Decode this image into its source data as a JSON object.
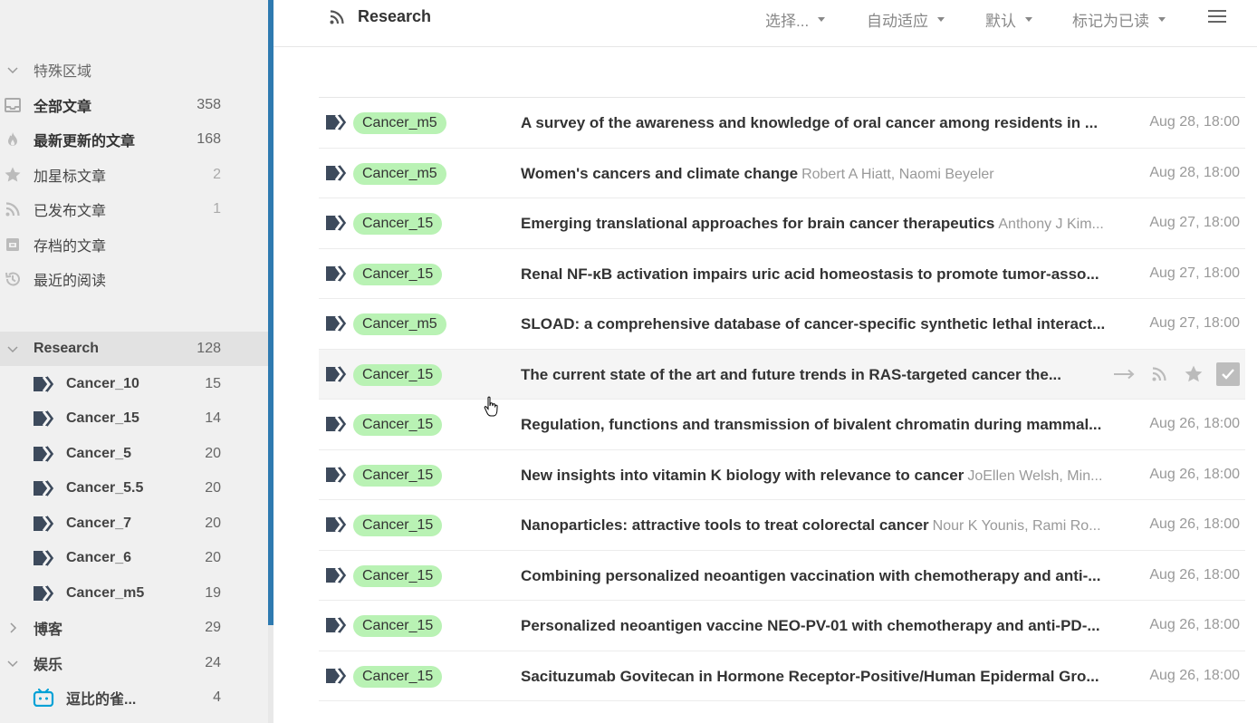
{
  "sidebar": {
    "special_section": {
      "label": "特殊区域"
    },
    "special_items": [
      {
        "label": "全部文章",
        "count": "358",
        "icon": "inbox-icon",
        "bold": true
      },
      {
        "label": "最新更新的文章",
        "count": "168",
        "icon": "fire-icon",
        "bold": true
      },
      {
        "label": "加星标文章",
        "count": "2",
        "icon": "star-icon",
        "bold": false
      },
      {
        "label": "已发布文章",
        "count": "1",
        "icon": "rss-icon",
        "bold": false
      },
      {
        "label": "存档的文章",
        "count": "",
        "icon": "archive-icon",
        "bold": false
      },
      {
        "label": "最近的阅读",
        "count": "",
        "icon": "history-icon",
        "bold": false
      }
    ],
    "research": {
      "label": "Research",
      "count": "128"
    },
    "research_feeds": [
      {
        "label": "Cancer_10",
        "count": "15"
      },
      {
        "label": "Cancer_15",
        "count": "14"
      },
      {
        "label": "Cancer_5",
        "count": "20"
      },
      {
        "label": "Cancer_5.5",
        "count": "20"
      },
      {
        "label": "Cancer_7",
        "count": "20"
      },
      {
        "label": "Cancer_6",
        "count": "20"
      },
      {
        "label": "Cancer_m5",
        "count": "19"
      }
    ],
    "blog": {
      "label": "博客",
      "count": "29"
    },
    "entertainment": {
      "label": "娱乐",
      "count": "24"
    },
    "entertainment_feeds": [
      {
        "label": "逗比的雀...",
        "count": "4"
      }
    ]
  },
  "header": {
    "title": "Research",
    "select_label": "选择...",
    "adapt_label": "自动适应",
    "default_label": "默认",
    "mark_read_label": "标记为已读"
  },
  "articles": [
    {
      "tag": "Cancer_m5",
      "title": "A survey of the awareness and knowledge of oral cancer among residents in ...",
      "authors": "",
      "date": "Aug 28, 18:00"
    },
    {
      "tag": "Cancer_m5",
      "title": "Women's cancers and climate change",
      "authors": "Robert A Hiatt, Naomi Beyeler",
      "date": "Aug 28, 18:00"
    },
    {
      "tag": "Cancer_15",
      "title": "Emerging translational approaches for brain cancer therapeutics",
      "authors": "Anthony J Kim...",
      "date": "Aug 27, 18:00"
    },
    {
      "tag": "Cancer_15",
      "title": "Renal NF-κB activation impairs uric acid homeostasis to promote tumor-asso...",
      "authors": "",
      "date": "Aug 27, 18:00"
    },
    {
      "tag": "Cancer_m5",
      "title": "SLOAD: a comprehensive database of cancer-specific synthetic lethal interact...",
      "authors": "",
      "date": "Aug 27, 18:00"
    },
    {
      "tag": "Cancer_15",
      "title": "The current state of the art and future trends in RAS-targeted cancer the...",
      "authors": "",
      "date": "",
      "hover": true
    },
    {
      "tag": "Cancer_15",
      "title": "Regulation, functions and transmission of bivalent chromatin during mammal...",
      "authors": "",
      "date": "Aug 26, 18:00"
    },
    {
      "tag": "Cancer_15",
      "title": "New insights into vitamin K biology with relevance to cancer",
      "authors": "JoEllen Welsh, Min...",
      "date": "Aug 26, 18:00"
    },
    {
      "tag": "Cancer_15",
      "title": "Nanoparticles: attractive tools to treat colorectal cancer",
      "authors": "Nour K Younis, Rami Ro...",
      "date": "Aug 26, 18:00"
    },
    {
      "tag": "Cancer_15",
      "title": "Combining personalized neoantigen vaccination with chemotherapy and anti-...",
      "authors": "",
      "date": "Aug 26, 18:00"
    },
    {
      "tag": "Cancer_15",
      "title": "Personalized neoantigen vaccine NEO-PV-01 with chemotherapy and anti-PD-...",
      "authors": "",
      "date": "Aug 26, 18:00"
    },
    {
      "tag": "Cancer_15",
      "title": "Sacituzumab Govitecan in Hormone Receptor-Positive/Human Epidermal Gro...",
      "authors": "",
      "date": "Aug 26, 18:00"
    }
  ],
  "colors": {
    "accent_bar": "#2e7ab0",
    "tag_background": "#b9f2b4",
    "feed_icon": "#3d4a5c",
    "bilibili_icon": "#00a1d6"
  }
}
